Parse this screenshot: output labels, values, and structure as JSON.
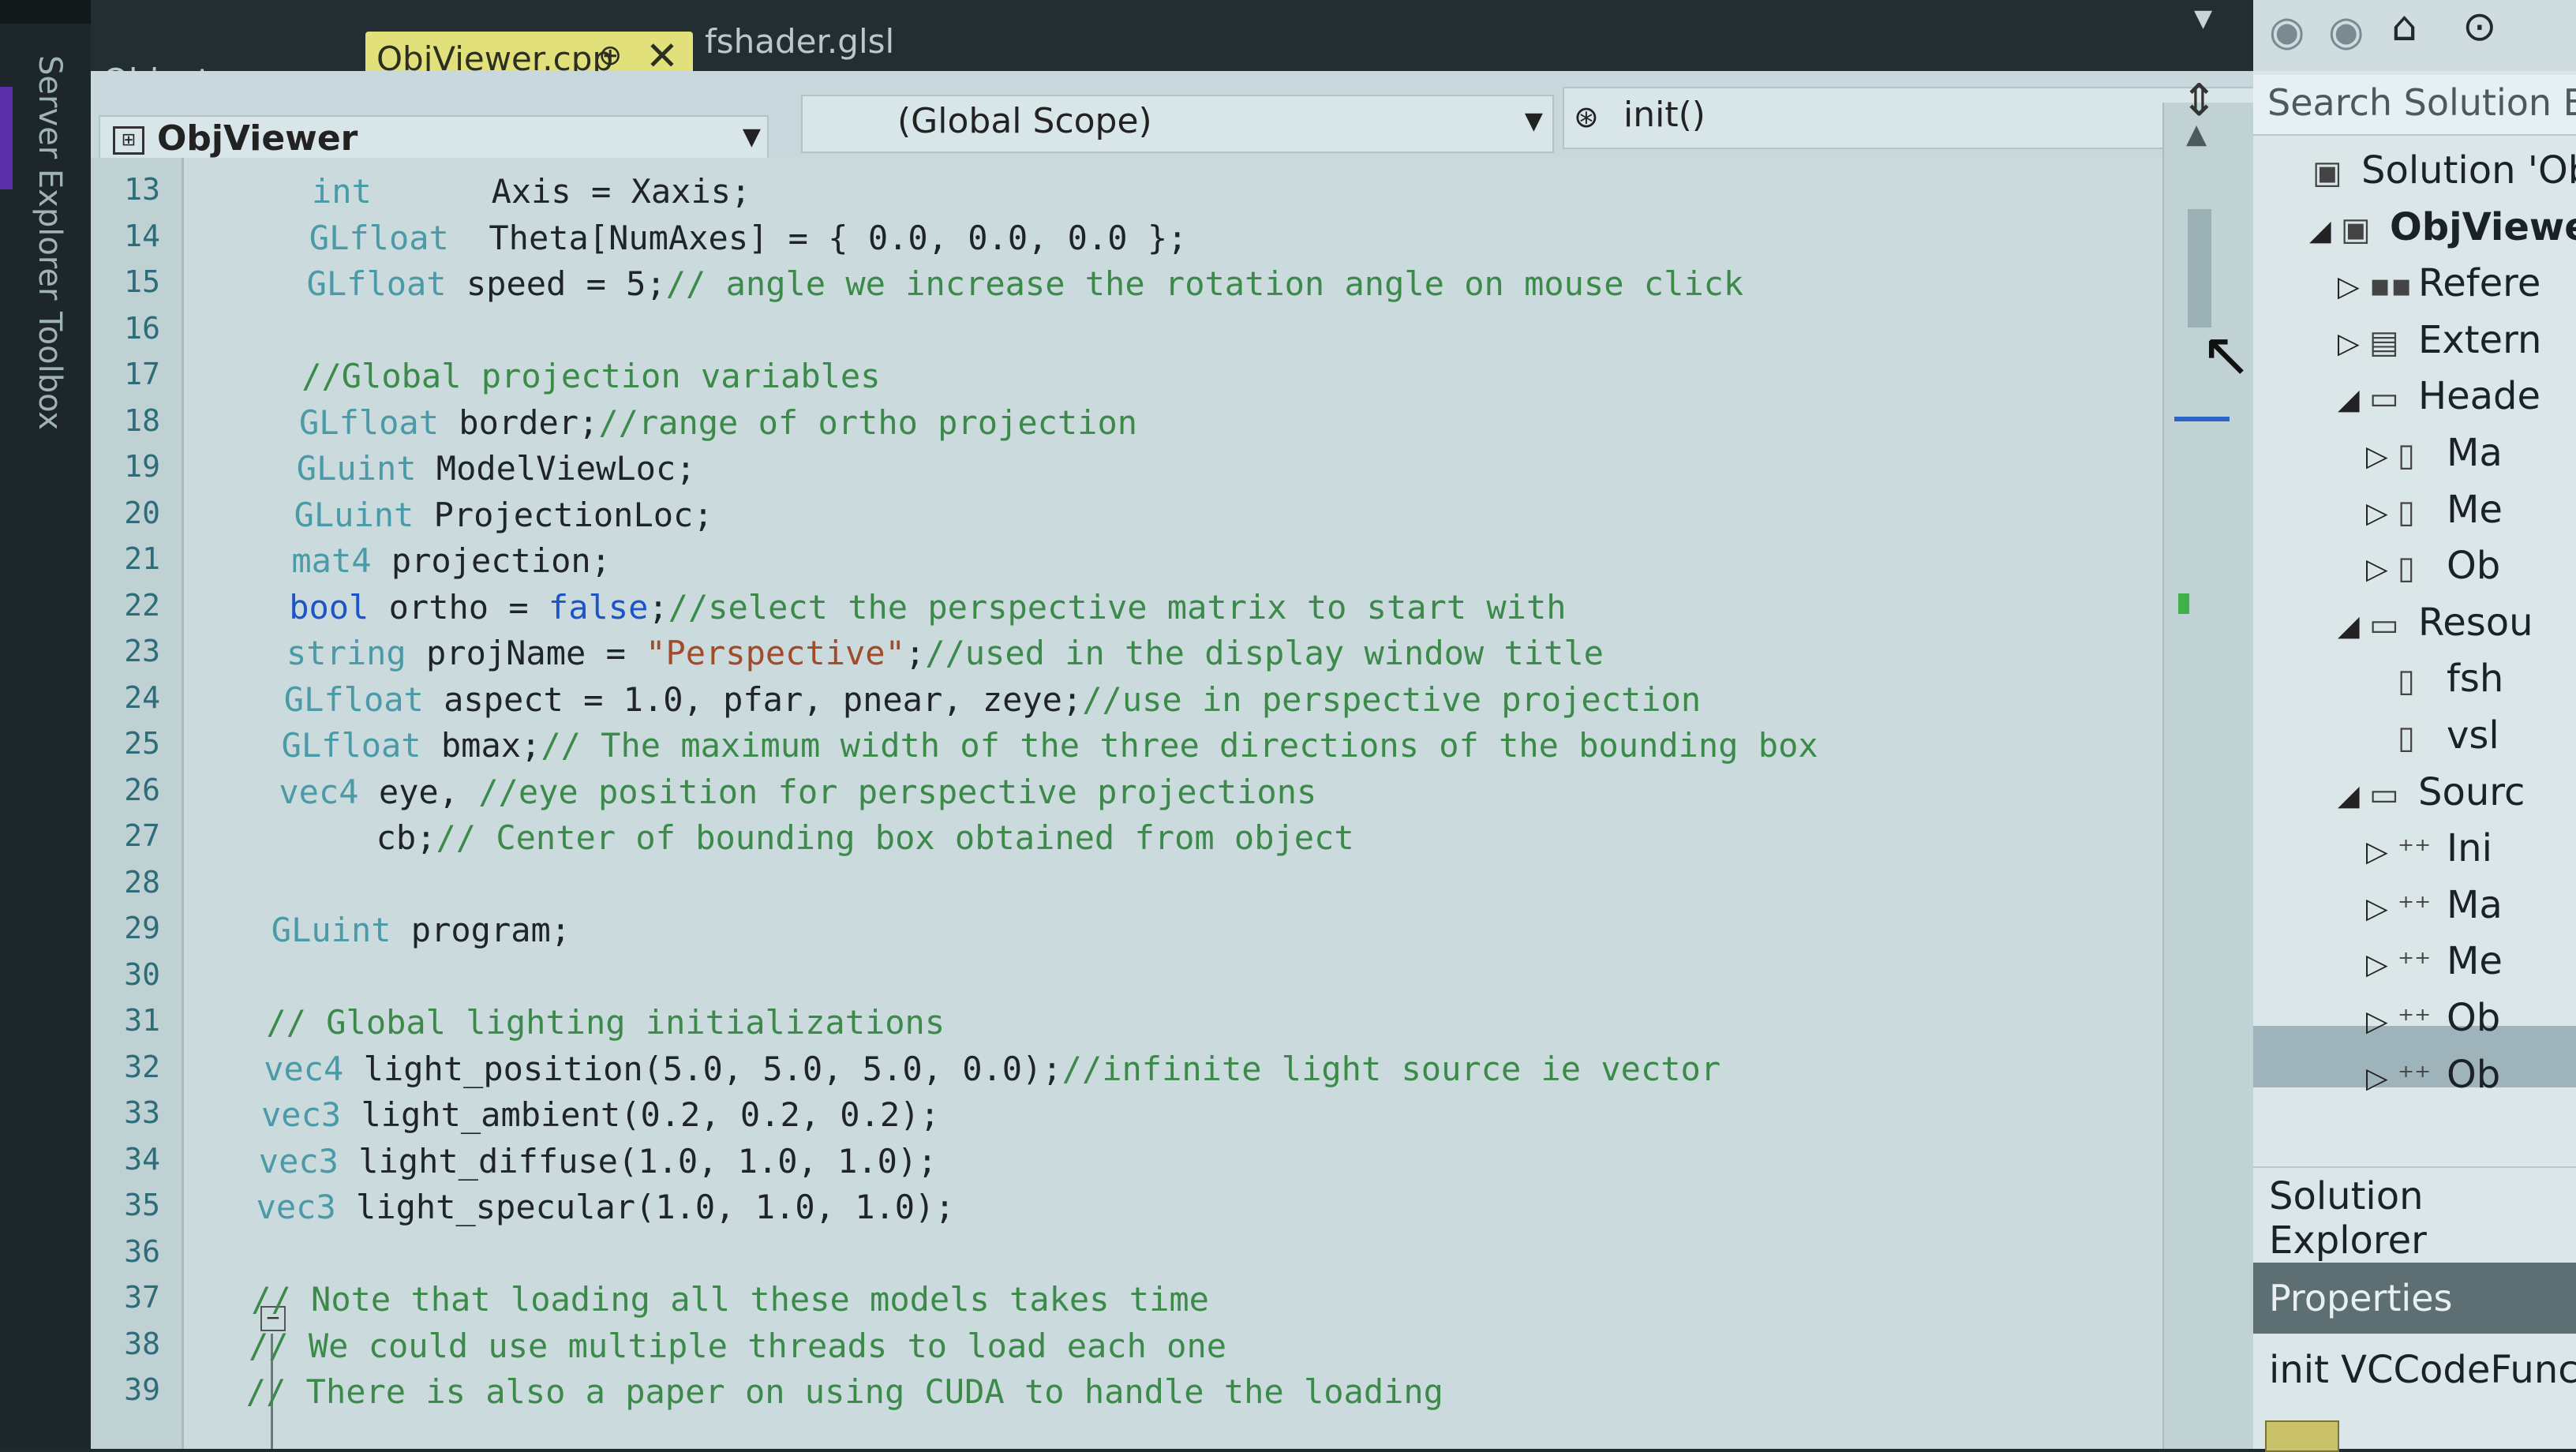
{
  "tool_tabs": {
    "server_explorer": "Server Explorer",
    "toolbox": "Toolbox"
  },
  "doc_tabs": {
    "object": "Object.cpp",
    "objviewer": "ObjViewer.cpp",
    "objviewer_pin": "⊕",
    "objviewer_close": "✕",
    "fshader": "fshader.glsl"
  },
  "navbar": {
    "project": "ObjViewer",
    "scope": "(Global Scope)",
    "member_icon": "⊛",
    "member": "init()"
  },
  "code_lines": [
    {
      "n": "13",
      "parts": [
        [
          "ty",
          "int"
        ],
        [
          "tx",
          "      Axis = Xaxis;"
        ]
      ]
    },
    {
      "n": "14",
      "parts": [
        [
          "ty",
          "GLfloat"
        ],
        [
          "tx",
          "  Theta[NumAxes] = { 0.0, 0.0, 0.0 };"
        ]
      ]
    },
    {
      "n": "15",
      "parts": [
        [
          "ty",
          "GLfloat"
        ],
        [
          "tx",
          " speed = 5;"
        ],
        [
          "cm",
          "// angle we increase the rotation angle on mouse click"
        ]
      ]
    },
    {
      "n": "16",
      "parts": []
    },
    {
      "n": "17",
      "parts": [
        [
          "cm",
          "//Global projection variables"
        ]
      ]
    },
    {
      "n": "18",
      "parts": [
        [
          "ty",
          "GLfloat"
        ],
        [
          "tx",
          " border;"
        ],
        [
          "cm",
          "//range of ortho projection"
        ]
      ]
    },
    {
      "n": "19",
      "parts": [
        [
          "ty",
          "GLuint"
        ],
        [
          "tx",
          " ModelViewLoc;"
        ]
      ]
    },
    {
      "n": "20",
      "parts": [
        [
          "ty",
          "GLuint"
        ],
        [
          "tx",
          " ProjectionLoc;"
        ]
      ]
    },
    {
      "n": "21",
      "parts": [
        [
          "ty",
          "mat4"
        ],
        [
          "tx",
          " projection;"
        ]
      ]
    },
    {
      "n": "22",
      "parts": [
        [
          "kw",
          "bool"
        ],
        [
          "tx",
          " ortho = "
        ],
        [
          "kw",
          "false"
        ],
        [
          "tx",
          ";"
        ],
        [
          "cm",
          "//select the perspective matrix to start with"
        ]
      ]
    },
    {
      "n": "23",
      "parts": [
        [
          "ty",
          "string"
        ],
        [
          "tx",
          " projName = "
        ],
        [
          "st",
          "\"Perspective\""
        ],
        [
          "tx",
          ";"
        ],
        [
          "cm",
          "//used in the display window title"
        ]
      ]
    },
    {
      "n": "24",
      "parts": [
        [
          "ty",
          "GLfloat"
        ],
        [
          "tx",
          " aspect = 1.0, pfar, pnear, zeye;"
        ],
        [
          "cm",
          "//use in perspective projection"
        ]
      ]
    },
    {
      "n": "25",
      "parts": [
        [
          "ty",
          "GLfloat"
        ],
        [
          "tx",
          " bmax;"
        ],
        [
          "cm",
          "// The maximum width of the three directions of the bounding box"
        ]
      ]
    },
    {
      "n": "26",
      "parts": [
        [
          "ty",
          "vec4"
        ],
        [
          "tx",
          " eye, "
        ],
        [
          "cm",
          "//eye position for perspective projections"
        ]
      ]
    },
    {
      "n": "27",
      "parts": [
        [
          "tx",
          "     cb;"
        ],
        [
          "cm",
          "// Center of bounding box obtained from object"
        ]
      ]
    },
    {
      "n": "28",
      "parts": []
    },
    {
      "n": "29",
      "parts": [
        [
          "ty",
          "GLuint"
        ],
        [
          "tx",
          " program;"
        ]
      ]
    },
    {
      "n": "30",
      "parts": []
    },
    {
      "n": "31",
      "parts": [
        [
          "cm",
          "// Global lighting initializations"
        ]
      ]
    },
    {
      "n": "32",
      "parts": [
        [
          "ty",
          "vec4"
        ],
        [
          "tx",
          " light_position(5.0, 5.0, 5.0, 0.0);"
        ],
        [
          "cm",
          "//infinite light source ie vector"
        ]
      ]
    },
    {
      "n": "33",
      "parts": [
        [
          "ty",
          "vec3"
        ],
        [
          "tx",
          " light_ambient(0.2, 0.2, 0.2);"
        ]
      ]
    },
    {
      "n": "34",
      "parts": [
        [
          "ty",
          "vec3"
        ],
        [
          "tx",
          " light_diffuse(1.0, 1.0, 1.0);"
        ]
      ]
    },
    {
      "n": "35",
      "parts": [
        [
          "ty",
          "vec3"
        ],
        [
          "tx",
          " light_specular(1.0, 1.0, 1.0);"
        ]
      ]
    },
    {
      "n": "36",
      "parts": []
    },
    {
      "n": "37",
      "parts": [
        [
          "cm",
          "// Note that loading all these models takes time"
        ]
      ]
    },
    {
      "n": "38",
      "parts": [
        [
          "cm",
          "// We could use multiple threads to load each one"
        ]
      ]
    },
    {
      "n": "39",
      "parts": [
        [
          "cm",
          "// There is also a paper on using CUDA to handle the loading"
        ]
      ]
    }
  ],
  "fold_glyph": "−",
  "scroll": {
    "up_glyph": "▲",
    "split_glyph": "⇕",
    "cursor_glyph": "↖"
  },
  "solution_explorer": {
    "search_placeholder": "Search Solution Ex",
    "tree": [
      {
        "indent": 0,
        "arrow": "",
        "icon": "▣",
        "label": "Solution 'Obj",
        "bold": false
      },
      {
        "indent": 1,
        "arrow": "◢",
        "icon": "▣",
        "label": "ObjViewe",
        "bold": true
      },
      {
        "indent": 2,
        "arrow": "▷",
        "icon": "▪▪",
        "label": "Refere",
        "bold": false
      },
      {
        "indent": 2,
        "arrow": "▷",
        "icon": "▤",
        "label": "Extern",
        "bold": false
      },
      {
        "indent": 2,
        "arrow": "◢",
        "icon": "▭",
        "label": "Heade",
        "bold": false
      },
      {
        "indent": 3,
        "arrow": "▷",
        "icon": "▯",
        "label": "Ma",
        "bold": false
      },
      {
        "indent": 3,
        "arrow": "▷",
        "icon": "▯",
        "label": "Me",
        "bold": false
      },
      {
        "indent": 3,
        "arrow": "▷",
        "icon": "▯",
        "label": "Ob",
        "bold": false
      },
      {
        "indent": 2,
        "arrow": "◢",
        "icon": "▭",
        "label": "Resou",
        "bold": false
      },
      {
        "indent": 3,
        "arrow": "",
        "icon": "▯",
        "label": "fsh",
        "bold": false
      },
      {
        "indent": 3,
        "arrow": "",
        "icon": "▯",
        "label": "vsl",
        "bold": false
      },
      {
        "indent": 2,
        "arrow": "◢",
        "icon": "▭",
        "label": "Sourc",
        "bold": false
      },
      {
        "indent": 3,
        "arrow": "▷",
        "icon": "⁺⁺",
        "label": "Ini",
        "bold": false
      },
      {
        "indent": 3,
        "arrow": "▷",
        "icon": "⁺⁺",
        "label": "Ma",
        "bold": false
      },
      {
        "indent": 3,
        "arrow": "▷",
        "icon": "⁺⁺",
        "label": "Me",
        "bold": false
      },
      {
        "indent": 3,
        "arrow": "▷",
        "icon": "⁺⁺",
        "label": "Ob",
        "bold": false
      },
      {
        "indent": 3,
        "arrow": "▷",
        "icon": "⁺⁺",
        "label": "Ob",
        "bold": false
      }
    ],
    "footer_label": "Solution Explorer"
  },
  "properties": {
    "header": "Properties",
    "value": "init VCCodeFunc"
  },
  "toolbar_icons": [
    "back-icon",
    "forward-icon",
    "home-icon",
    "sync-icon"
  ]
}
